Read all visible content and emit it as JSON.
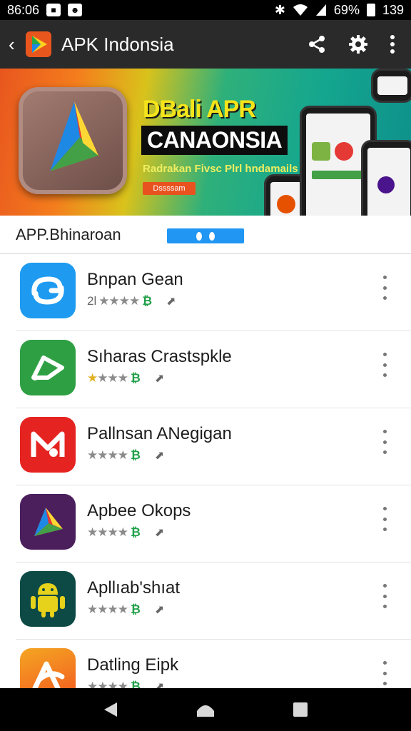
{
  "status_bar": {
    "time": "86:06",
    "battery": "69%",
    "clock_right": "139",
    "icons": [
      "notification-icon",
      "android-icon",
      "bluetooth-icon",
      "wifi-icon",
      "signal-icon",
      "battery-icon"
    ]
  },
  "app_bar": {
    "title": "APK Indonsia",
    "actions": [
      "share-icon",
      "settings-icon",
      "more-vert-icon"
    ]
  },
  "banner": {
    "headline": "DBali APR",
    "name": "CANAONSIA",
    "tagline": "Radrakan Fivsc Plrl hndamails",
    "button_label": "Dssssam"
  },
  "section": {
    "title": "APP.Bhinaroan"
  },
  "apps": [
    {
      "name": "Bnpan Gean",
      "prefix": "2l",
      "stars": "★★★★",
      "gold_stars": 0,
      "icon": "blue-swirl-icon",
      "icon_color": "#1e9bf0"
    },
    {
      "name": "Sıharas Crastspkle",
      "prefix": "",
      "stars": "★★★★",
      "gold_stars": 1,
      "icon": "green-arrow-icon",
      "icon_color": "#2ea043"
    },
    {
      "name": "Pallnsan ANegigan",
      "prefix": "",
      "stars": "★★★★",
      "gold_stars": 0,
      "icon": "red-m-icon",
      "icon_color": "#e52421"
    },
    {
      "name": "Apbee Okops",
      "prefix": "",
      "stars": "★★★★",
      "gold_stars": 0,
      "icon": "purple-triangle-icon",
      "icon_color": "#4a1f5c"
    },
    {
      "name": "Apllıab'shıat",
      "prefix": "",
      "stars": "★★★★",
      "gold_stars": 0,
      "icon": "android-robot-icon",
      "icon_color": "#0d4a46"
    },
    {
      "name": "Datling Eipk",
      "prefix": "",
      "stars": "★★★★",
      "gold_stars": 0,
      "icon": "orange-swirl-icon",
      "icon_color": "#f57c1f"
    }
  ],
  "nav_bar": {
    "buttons": [
      "back-triangle-icon",
      "home-icon",
      "recents-square-icon"
    ]
  }
}
